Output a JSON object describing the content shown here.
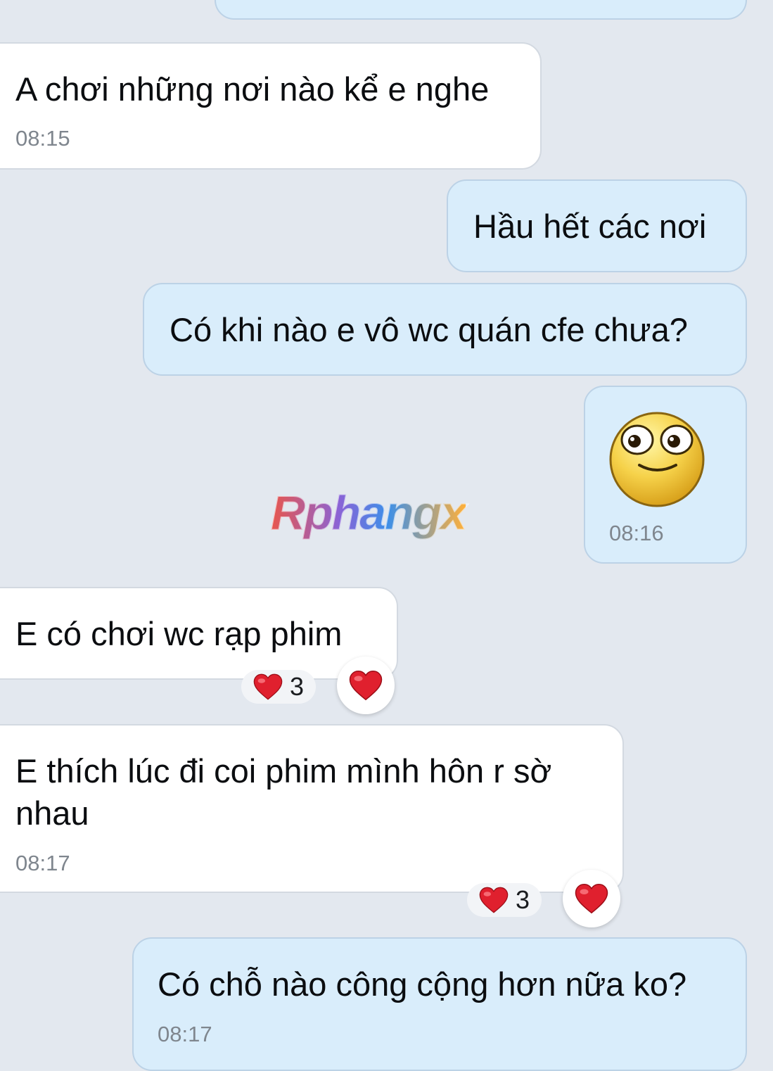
{
  "watermark": "Rphangx",
  "messages": [
    {
      "text": "A chơi những nơi nào kể e nghe",
      "time": "08:15"
    },
    {
      "text": "Hầu hết các nơi"
    },
    {
      "text": "Có khi nào e vô wc quán cfe chưa?"
    },
    {
      "sticker": "smiling-face-sticker",
      "time": "08:16"
    },
    {
      "text": "E có chơi wc rạp phim",
      "reaction": {
        "emoji": "heart",
        "count": "3"
      }
    },
    {
      "line1": "E thích lúc đi coi phim mình hôn r sờ",
      "line2": "nhau",
      "time": "08:17",
      "reaction": {
        "emoji": "heart",
        "count": "3"
      }
    },
    {
      "text": "Có chỗ nào công cộng hơn nữa ko?",
      "time": "08:17"
    }
  ],
  "colors": {
    "background": "#e3e8ef",
    "incoming_bubble": "#ffffff",
    "outgoing_bubble": "#d9edfb",
    "heart": "#e0202e"
  }
}
